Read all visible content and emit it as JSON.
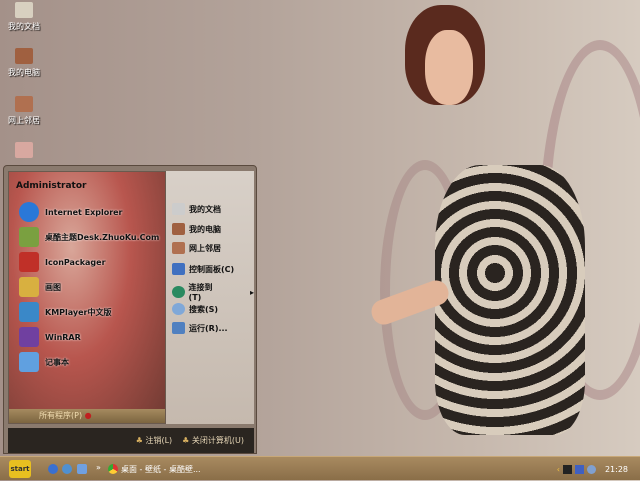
{
  "desktop": {
    "icons": [
      {
        "label": "我的文档"
      },
      {
        "label": "我的电脑"
      },
      {
        "label": "网上邻居"
      },
      {
        "label": ""
      }
    ]
  },
  "start_menu": {
    "user": "Administrator",
    "programs": [
      {
        "label": "Internet Explorer",
        "color": "#2a78d8"
      },
      {
        "label": "桌酷主题Desk.ZhuoKu.Com",
        "color": "#7aa040"
      },
      {
        "label": "IconPackager",
        "color": "#c03028"
      },
      {
        "label": "画图",
        "color": "#d8b040"
      },
      {
        "label": "KMPlayer中文版",
        "color": "#3a88c8"
      },
      {
        "label": "WinRAR",
        "color": "#7040a0"
      },
      {
        "label": "记事本",
        "color": "#60a0e0"
      }
    ],
    "all_programs": "所有程序(P)",
    "places": [
      {
        "label": "我的文档"
      },
      {
        "label": "我的电脑"
      },
      {
        "label": "网上邻居"
      },
      {
        "label": "控制面板(C)"
      },
      {
        "label": "连接到(T)"
      },
      {
        "label": "搜索(S)"
      },
      {
        "label": "运行(R)..."
      }
    ],
    "logoff": "注销(L)",
    "shutdown": "关闭计算机(U)"
  },
  "taskbar": {
    "start": "start",
    "task": "桌面 - 壁纸 - 桌酷壁...",
    "clock": "21:28"
  }
}
